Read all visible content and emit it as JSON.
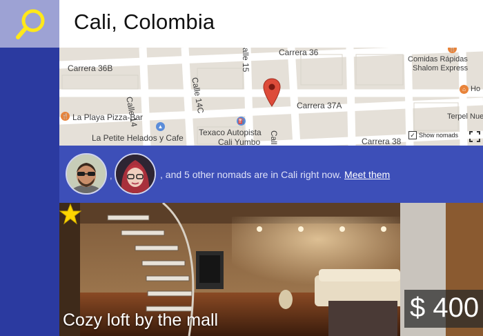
{
  "header": {
    "city": "Cali, Colombia"
  },
  "search": {
    "icon": "search-icon"
  },
  "map": {
    "streets": {
      "carrera_36": "Carrera 36",
      "carrera_36b": "Carrera 36B",
      "carrera_37a": "Carrera 37A",
      "carrera_38": "Carrera 38",
      "calle_14": "Calle 14",
      "calle_14c": "Calle 14C",
      "calle_15": "alle 15",
      "calle_partial": "Call"
    },
    "places": {
      "pizza": "La Playa Pizza-Bar",
      "helados": "La Petite Helados y Cafe",
      "texaco_line1": "Texaco Autopista",
      "texaco_line2": "Cali Yumbo",
      "comidas_line1": "Comidas Rápidas",
      "comidas_line2": "Shalom Express",
      "terpel": "Terpel Nue",
      "ho": "Ho"
    },
    "show_nomads_label": "Show nomads",
    "show_nomads_checked": "✓"
  },
  "nomads": {
    "comma": ",",
    "text": ", and 5 other nomads are in Cali right now.",
    "link": "Meet them"
  },
  "listing": {
    "title": "Cozy loft by the mall",
    "price": "$ 400"
  },
  "colors": {
    "sidebar": "#2b3aa0",
    "search_tile": "#9da2d4",
    "nomads_bar": "#3d4fb8",
    "marker": "#dd4b39",
    "star": "#ffd600"
  }
}
